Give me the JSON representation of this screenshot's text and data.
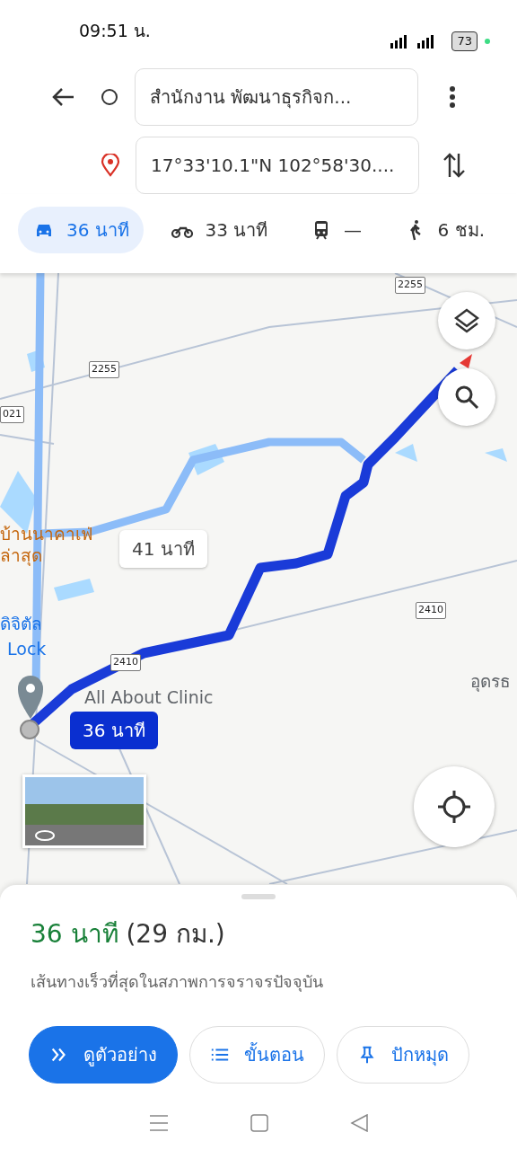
{
  "status_bar": {
    "time": "09:51 น.",
    "battery": "73"
  },
  "directions": {
    "origin": "สำนักงาน พัฒนาธุรกิจก...",
    "destination": "17°33'10.1\"N 102°58'30...."
  },
  "travel_modes": [
    {
      "kind": "car",
      "label": "36 นาที",
      "selected": true
    },
    {
      "kind": "motorbike",
      "label": "33 นาที",
      "selected": false
    },
    {
      "kind": "transit",
      "label": "—",
      "selected": false
    },
    {
      "kind": "walk",
      "label": "6 ชม.",
      "selected": false
    }
  ],
  "map": {
    "labels": [
      {
        "kind": "road",
        "text": "2255"
      },
      {
        "kind": "road",
        "text": "2255"
      },
      {
        "kind": "road",
        "text": "021"
      },
      {
        "kind": "road",
        "text": "2410"
      },
      {
        "kind": "road",
        "text": "2410"
      },
      {
        "kind": "place",
        "text": "บ้านนาคาเฟ่"
      },
      {
        "kind": "place",
        "text": "ล่าสุด"
      },
      {
        "kind": "poi",
        "text": "ดิจิตัล"
      },
      {
        "kind": "poi",
        "text": "Lock"
      },
      {
        "kind": "area",
        "text": "All About Clinic"
      },
      {
        "kind": "area",
        "text": "อุดรธ"
      }
    ],
    "route_bubbles": [
      {
        "text": "41 นาที",
        "selected": false
      },
      {
        "text": "36 นาที",
        "selected": true
      }
    ]
  },
  "summary": {
    "duration": "36 นาที",
    "distance": "(29 กม.)",
    "description": "เส้นทางเร็วที่สุดในสภาพการจราจรปัจจุบัน"
  },
  "actions": [
    {
      "kind": "preview",
      "label": "ดูตัวอย่าง",
      "primary": true
    },
    {
      "kind": "steps",
      "label": "ขั้นตอน",
      "primary": false
    },
    {
      "kind": "pin",
      "label": "ปักหมุด",
      "primary": false
    }
  ]
}
